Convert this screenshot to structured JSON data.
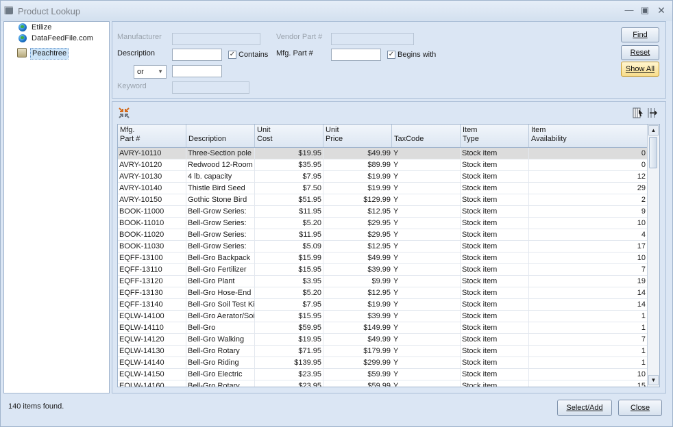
{
  "window": {
    "title": "Product Lookup"
  },
  "tree": {
    "items": [
      {
        "label": "Etilize",
        "icon": "globe-icon"
      },
      {
        "label": "DataFeedFile.com",
        "icon": "globe-icon"
      },
      {
        "label": "Peachtree",
        "icon": "database-icon"
      }
    ]
  },
  "search": {
    "manufacturer_label": "Manufacturer",
    "manufacturer_value": "",
    "vendor_part_label": "Vendor Part #",
    "vendor_part_value": "",
    "description_label": "Description",
    "description_value": "",
    "contains_label": "Contains",
    "contains_checked": true,
    "mfg_part_label": "Mfg. Part #",
    "mfg_part_value": "",
    "begins_with_label": "Begins with",
    "begins_with_checked": true,
    "operator_value": "or",
    "description2_value": "",
    "keyword_label": "Keyword",
    "keyword_value": ""
  },
  "buttons": {
    "find": "Find",
    "reset": "Reset",
    "show_all": "Show All",
    "select_add": "Select/Add",
    "close": "Close"
  },
  "grid": {
    "columns": [
      {
        "line1": "Mfg.",
        "line2": "Part #"
      },
      {
        "line1": "",
        "line2": "Description"
      },
      {
        "line1": "Unit",
        "line2": "Cost"
      },
      {
        "line1": "Unit",
        "line2": "Price"
      },
      {
        "line1": "",
        "line2": "TaxCode"
      },
      {
        "line1": "Item",
        "line2": "Type"
      },
      {
        "line1": "Item",
        "line2": "Availability"
      }
    ],
    "rows": [
      [
        "AVRY-10110",
        "Three-Section pole",
        "$19.95",
        "$49.99",
        "Y",
        "Stock item",
        "0"
      ],
      [
        "AVRY-10120",
        "Redwood 12-Room",
        "$35.95",
        "$89.99",
        "Y",
        "Stock item",
        "0"
      ],
      [
        "AVRY-10130",
        "4 lb. capacity",
        "$7.95",
        "$19.99",
        "Y",
        "Stock item",
        "12"
      ],
      [
        "AVRY-10140",
        "Thistle Bird Seed",
        "$7.50",
        "$19.99",
        "Y",
        "Stock item",
        "29"
      ],
      [
        "AVRY-10150",
        "Gothic Stone Bird",
        "$51.95",
        "$129.99",
        "Y",
        "Stock item",
        "2"
      ],
      [
        "BOOK-11000",
        "Bell-Grow Series:",
        "$11.95",
        "$12.95",
        "Y",
        "Stock item",
        "9"
      ],
      [
        "BOOK-11010",
        "Bell-Grow Series:",
        "$5.20",
        "$29.95",
        "Y",
        "Stock item",
        "10"
      ],
      [
        "BOOK-11020",
        "Bell-Grow Series:",
        "$11.95",
        "$29.95",
        "Y",
        "Stock item",
        "4"
      ],
      [
        "BOOK-11030",
        "Bell-Grow Series:",
        "$5.09",
        "$12.95",
        "Y",
        "Stock item",
        "17"
      ],
      [
        "EQFF-13100",
        "Bell-Gro Backpack",
        "$15.99",
        "$49.99",
        "Y",
        "Stock item",
        "10"
      ],
      [
        "EQFF-13110",
        "Bell-Gro Fertilizer",
        "$15.95",
        "$39.99",
        "Y",
        "Stock item",
        "7"
      ],
      [
        "EQFF-13120",
        "Bell-Gro Plant",
        "$3.95",
        "$9.99",
        "Y",
        "Stock item",
        "19"
      ],
      [
        "EQFF-13130",
        "Bell-Gro Hose-End",
        "$5.20",
        "$12.95",
        "Y",
        "Stock item",
        "14"
      ],
      [
        "EQFF-13140",
        "Bell-Gro Soil Test Kit",
        "$7.95",
        "$19.99",
        "Y",
        "Stock item",
        "14"
      ],
      [
        "EQLW-14100",
        "Bell-Gro Aerator/Soil",
        "$15.95",
        "$39.99",
        "Y",
        "Stock item",
        "1"
      ],
      [
        "EQLW-14110",
        "Bell-Gro",
        "$59.95",
        "$149.99",
        "Y",
        "Stock item",
        "1"
      ],
      [
        "EQLW-14120",
        "Bell-Gro Walking",
        "$19.95",
        "$49.99",
        "Y",
        "Stock item",
        "7"
      ],
      [
        "EQLW-14130",
        "Bell-Gro Rotary",
        "$71.95",
        "$179.99",
        "Y",
        "Stock item",
        "1"
      ],
      [
        "EQLW-14140",
        "Bell-Gro Riding",
        "$139.95",
        "$299.99",
        "Y",
        "Stock item",
        "1"
      ],
      [
        "EQLW-14150",
        "Bell-Gro Electric",
        "$23.95",
        "$59.99",
        "Y",
        "Stock item",
        "10"
      ],
      [
        "EQLW-14160",
        "Bell-Gro Rotary",
        "$23.95",
        "$59.99",
        "Y",
        "Stock item",
        "15"
      ]
    ]
  },
  "status": {
    "text": "140 items found."
  }
}
